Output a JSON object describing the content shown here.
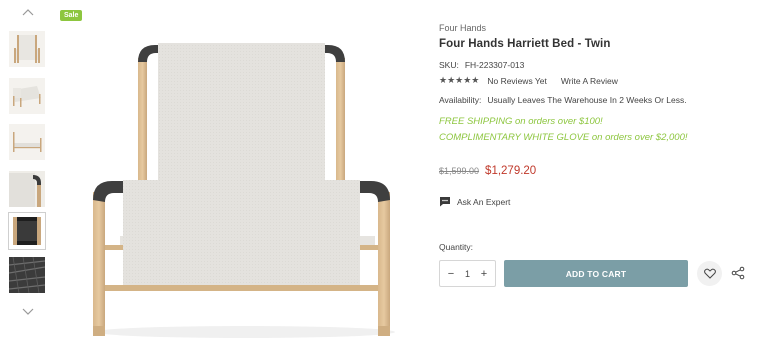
{
  "badge": {
    "sale": "Sale"
  },
  "gallery": {
    "thumbnails": [
      {
        "name": "bed-front-view"
      },
      {
        "name": "bed-angled-view"
      },
      {
        "name": "bed-side-view"
      },
      {
        "name": "bed-corner-closeup"
      },
      {
        "name": "bed-frame-closeup"
      },
      {
        "name": "fabric-swatch-closeup"
      }
    ],
    "active_index": 4,
    "nav_up_icon": "chevron-up-icon",
    "nav_down_icon": "chevron-down-icon"
  },
  "product": {
    "brand": "Four Hands",
    "title": "Four Hands Harriett Bed - Twin",
    "sku_label": "SKU:",
    "sku_value": "FH-223307-013",
    "stars": "★★★★★",
    "no_reviews": "No Reviews Yet",
    "write_review": "Write A Review",
    "availability_label": "Availability:",
    "availability_value": "Usually Leaves The Warehouse In 2 Weeks Or Less.",
    "promo_shipping": "FREE SHIPPING on orders over $100!",
    "promo_glove": "COMPLIMENTARY WHITE GLOVE on orders over $2,000!",
    "old_price": "$1,599.00",
    "new_price": "$1,279.20",
    "ask_expert": "Ask An Expert",
    "quantity_label": "Quantity:",
    "quantity_value": "1",
    "qty_minus": "−",
    "qty_plus": "+",
    "add_to_cart": "ADD TO CART"
  },
  "colors": {
    "sale_green": "#8dc63f",
    "price_red": "#c0392b",
    "cart_button": "#7b9ea6"
  }
}
